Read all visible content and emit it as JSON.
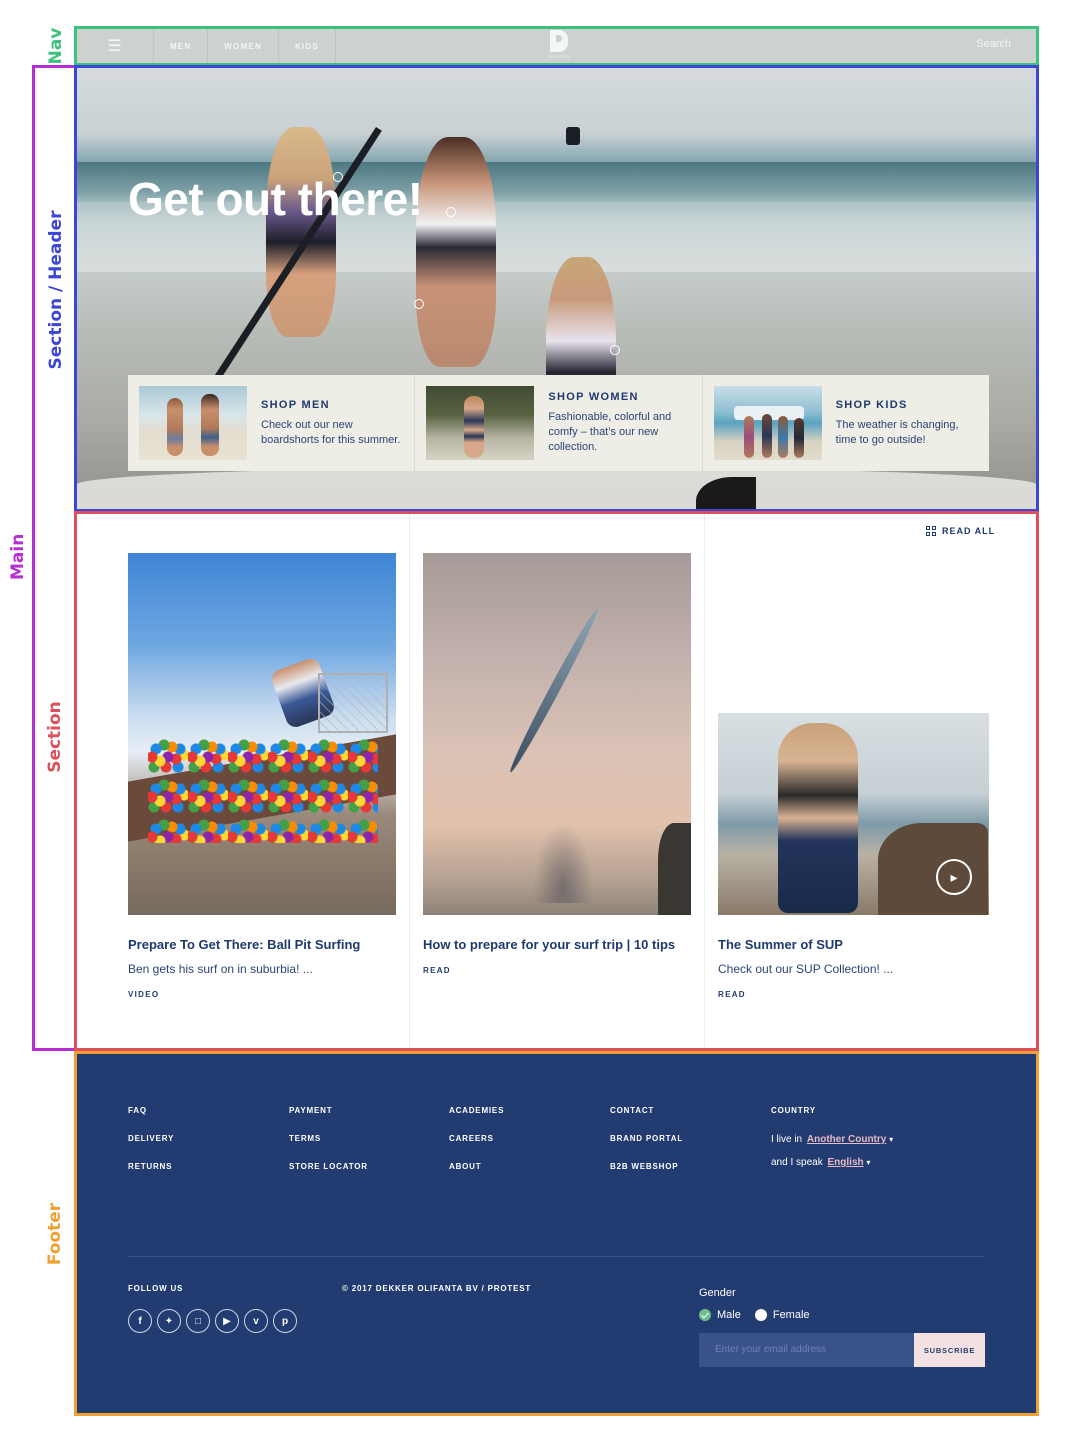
{
  "annotations": {
    "nav": {
      "label": "Nav",
      "color": "#3cc27c"
    },
    "main": {
      "label": "Main",
      "color": "#b52fd2"
    },
    "header": {
      "label": "Section / Header",
      "color": "#3b46d6"
    },
    "section": {
      "label": "Section",
      "color": "#dc4f5d"
    },
    "footer": {
      "label": "Footer",
      "color": "#f0a030"
    }
  },
  "nav": {
    "menu_icon": "hamburger-icon",
    "links": [
      "MEN",
      "WOMEN",
      "KIDS"
    ],
    "logo_text": "PROTEST",
    "search_label": "Search"
  },
  "hero": {
    "title": "Get out there!",
    "shop": [
      {
        "title": "SHOP MEN",
        "desc": "Check out our new boardshorts for this summer."
      },
      {
        "title": "SHOP WOMEN",
        "desc": "Fashionable, colorful and comfy – that’s our new collection."
      },
      {
        "title": "SHOP KIDS",
        "desc": "The weather is changing, time to go outside!"
      }
    ]
  },
  "articles": {
    "read_all": "READ ALL",
    "items": [
      {
        "title": "Prepare To Get There: Ball Pit Surfing",
        "desc": "Ben gets his surf on in suburbia! ...",
        "tag": "VIDEO"
      },
      {
        "title": "How to prepare for your surf trip | 10 tips",
        "desc": "",
        "tag": "READ"
      },
      {
        "title": "The Summer of SUP",
        "desc": "Check out our SUP Collection! ...",
        "tag": "READ"
      }
    ]
  },
  "footer": {
    "col1": [
      "FAQ",
      "DELIVERY",
      "RETURNS"
    ],
    "col2": [
      "PAYMENT",
      "TERMS",
      "STORE LOCATOR"
    ],
    "col3": [
      "ACADEMIES",
      "CAREERS",
      "ABOUT"
    ],
    "col4": [
      "CONTACT",
      "BRAND PORTAL",
      "B2B WEBSHOP"
    ],
    "country_heading": "COUNTRY",
    "live_in": "I live in",
    "country_value": "Another Country",
    "speak": "and I speak",
    "language_value": "English",
    "follow_us": "FOLLOW US",
    "copyright": "© 2017 DEKKER OLIFANTA BV / PROTEST",
    "socials": [
      "facebook-icon",
      "twitter-icon",
      "instagram-icon",
      "youtube-icon",
      "vimeo-icon",
      "pinterest-icon"
    ],
    "gender_label": "Gender",
    "gender_options": [
      "Male",
      "Female"
    ],
    "gender_selected": "Male",
    "email_placeholder": "Enter your email address",
    "subscribe_label": "SUBSCRIBE"
  },
  "colors": {
    "brand_navy": "#223b70",
    "accent_pink": "#e8b9c6",
    "check_green": "#6fbf8c"
  }
}
